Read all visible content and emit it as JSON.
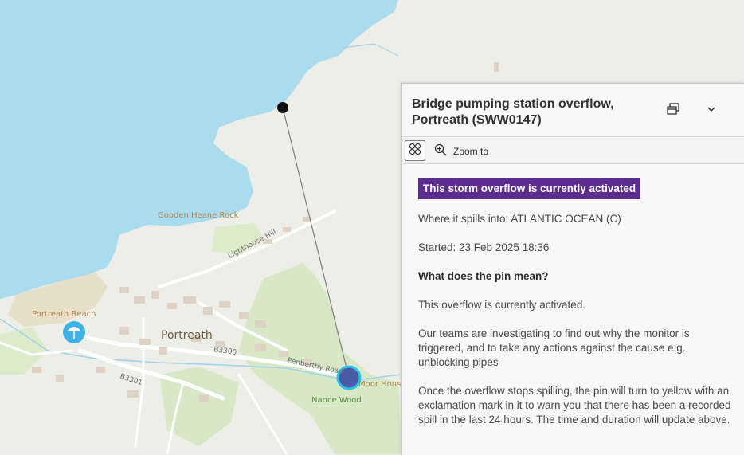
{
  "map": {
    "labels": {
      "town": "Portreath",
      "beach": "Portreath Beach",
      "headland": "Gooden Heane Rock",
      "lighthouse_hill": "Lighthouse Hill",
      "b3300": "B3300",
      "b3301": "B3301",
      "penberthy_road": "Penberthy Road",
      "nance_wood": "Nance Wood",
      "moor_house": "Moor House"
    },
    "colors": {
      "sea": "#aadcef",
      "land": "#eeeee8",
      "green": "#d7e8c6",
      "buildings": "#ddd2c3",
      "pin": "#4a5aa6",
      "pin_ring": "#27c3e8",
      "beach_icon": "#3fb1e3"
    },
    "icons": {
      "beach_poi": "beach-umbrella-icon",
      "overflow_pin": "circle-marker",
      "leader_anchor": "black-dot"
    }
  },
  "popup": {
    "title": "Bridge pumping station overflow, Portreath (SWW0147)",
    "dock_icon": "dock-icon",
    "collapse_icon": "chevron-down-icon",
    "toolbar": {
      "select_icon": "grid-select-icon",
      "zoom_icon": "zoom-in-icon",
      "zoom_label": "Zoom to"
    },
    "status_banner": "This storm overflow is currently activated",
    "status_color": "#5c2d91",
    "spills_into": "Where it spills into: ATLANTIC OCEAN (C)",
    "started": "Started: 23 Feb 2025 18:36",
    "pin_question": "What does the pin mean?",
    "pin_answer_1": "This overflow is currently activated.",
    "pin_answer_2": "Our teams are investigating to find out why the monitor is triggered, and to take any actions against the cause e.g. unblocking pipes",
    "pin_answer_3": "Once the overflow stops spilling, the pin will turn to yellow with an exclamation mark in it to warn you that there has been a recorded spill in the last 24 hours. The time and duration will update above."
  }
}
